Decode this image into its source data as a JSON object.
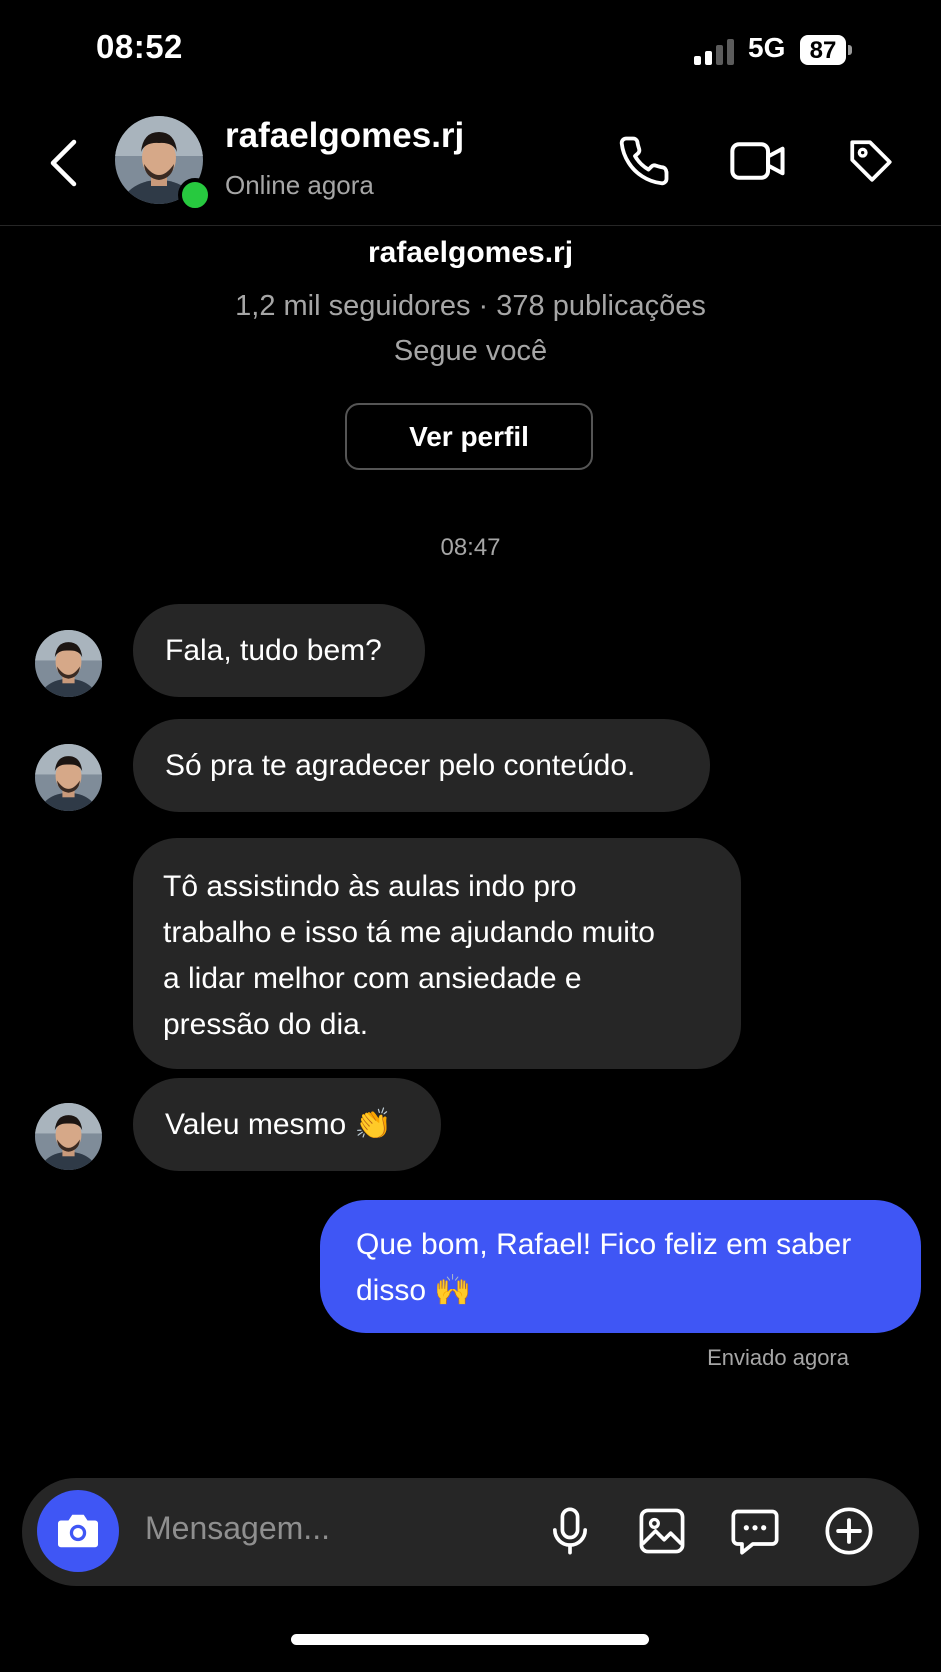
{
  "status_bar": {
    "time": "08:52",
    "network": "5G",
    "battery": "87"
  },
  "header": {
    "username": "rafaelgomes.rj",
    "presence": "Online agora",
    "icons": [
      "back-icon",
      "phone-icon",
      "video-icon",
      "tag-icon"
    ]
  },
  "profile": {
    "username": "rafaelgomes.rj",
    "stats": "1,2 mil seguidores · 378 publicações",
    "follow_status": "Segue você",
    "view_profile_label": "Ver perfil"
  },
  "thread": {
    "timestamp": "08:47",
    "messages": [
      {
        "from": "them",
        "text": "Fala, tudo bem?"
      },
      {
        "from": "them",
        "text": "Só pra te agradecer pelo conteúdo."
      },
      {
        "from": "them",
        "lines": [
          "Tô assistindo às aulas indo pro",
          "trabalho e isso tá me ajudando muito",
          "a lidar melhor com ansiedade e",
          "pressão do dia."
        ]
      },
      {
        "from": "them",
        "text": "Valeu mesmo 👏"
      },
      {
        "from": "me",
        "lines": [
          "Que bom, Rafael! Fico feliz em saber",
          "disso 🙌"
        ]
      }
    ],
    "sent_status": "Enviado agora"
  },
  "composer": {
    "placeholder": "Mensagem...",
    "icons": [
      "camera-icon",
      "microphone-icon",
      "gallery-icon",
      "chat-bubble-icon",
      "add-icon"
    ]
  },
  "colors": {
    "accent": "#3f56f5",
    "bubble_incoming": "#262626",
    "online": "#27c93f",
    "muted_text": "#a6a6a6"
  }
}
